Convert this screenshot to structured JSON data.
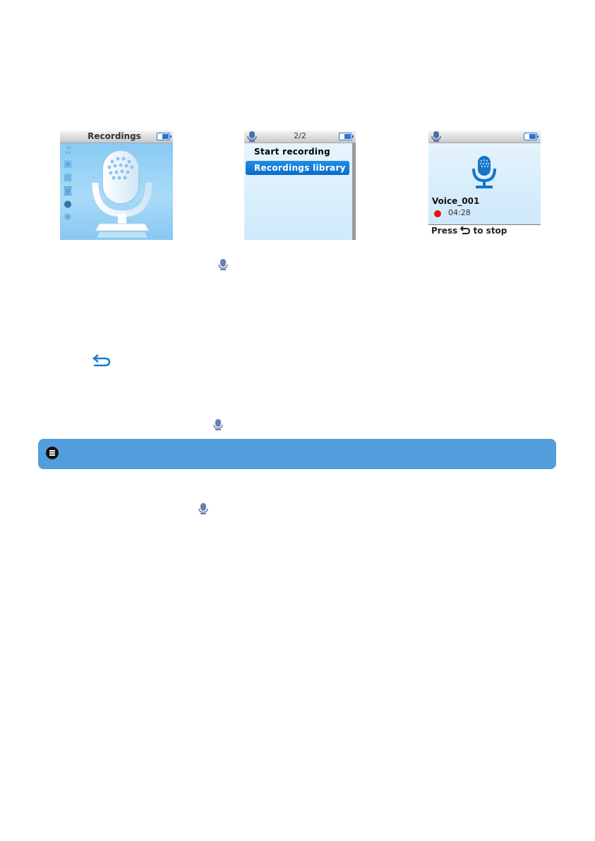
{
  "screens": {
    "main_menu": {
      "title": "Recordings",
      "side_icons": [
        "music-icon",
        "photo-icon",
        "video-icon",
        "camera-icon",
        "microphone-icon",
        "settings-icon"
      ]
    },
    "recording_menu": {
      "page": "2/2",
      "items": [
        {
          "label": "Start recording",
          "selected": false
        },
        {
          "label": "Recordings library",
          "selected": true
        }
      ]
    },
    "recording_screen": {
      "file_name": "Voice_001",
      "elapsed": "04:28",
      "caption_prefix": "Press",
      "caption_suffix": "to stop"
    }
  },
  "colors": {
    "accent": "#1f8ee6",
    "note_bar": "#529edc",
    "record_dot": "#e8121b"
  }
}
